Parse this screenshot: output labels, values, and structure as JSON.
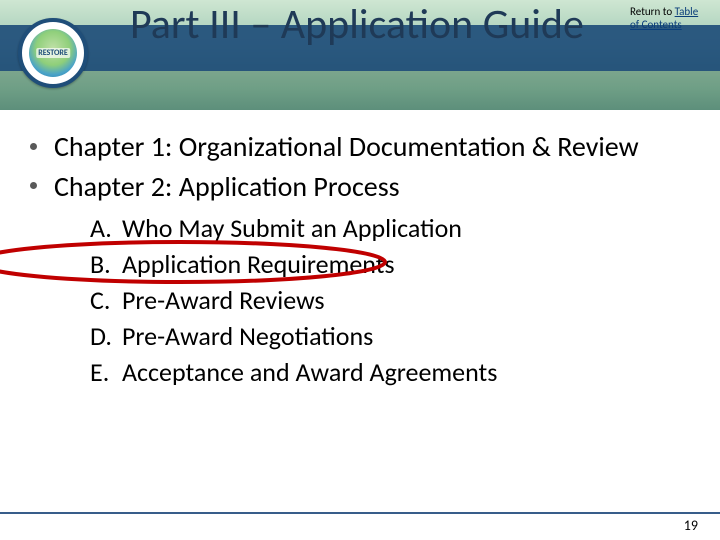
{
  "header": {
    "title": "Part III – Application Guide",
    "logo_label": "RESTORE",
    "toc_prefix": "Return to ",
    "toc_link": "Table of Contents"
  },
  "content": {
    "chapters": [
      "Chapter 1: Organizational Documentation & Review",
      "Chapter 2:  Application Process"
    ],
    "sub_letters": [
      "A.",
      "B.",
      "C.",
      "D.",
      "E."
    ],
    "sub_items": [
      "Who May Submit an Application",
      "Application Requirements",
      "Pre-Award Reviews",
      "Pre-Award Negotiations",
      "Acceptance and Award Agreements"
    ],
    "highlighted_index": 1
  },
  "footer": {
    "page_number": "19"
  },
  "colors": {
    "banner_stripe": "#1f4e79",
    "circle": "#c00000"
  }
}
